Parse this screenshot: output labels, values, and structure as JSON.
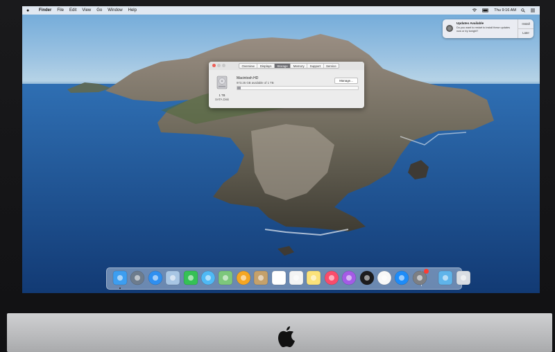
{
  "menubar": {
    "app": "Finder",
    "items": [
      "File",
      "Edit",
      "View",
      "Go",
      "Window",
      "Help"
    ],
    "clock": "Thu 9:16 AM"
  },
  "notification": {
    "title": "Updates Available",
    "body": "Do you want to restart to install these updates now or try tonight?",
    "install_label": "Install",
    "later_label": "Later"
  },
  "about_window": {
    "tabs": [
      "Overview",
      "Displays",
      "Storage",
      "Memory",
      "Support",
      "Service"
    ],
    "active_tab": "Storage",
    "disk_name": "Macintosh HD",
    "available": "973.25 GB available of 1 TB",
    "used_fraction": 0.03,
    "disk_size": "1 TB",
    "disk_type": "SATA Disk",
    "manage_label": "Manage..."
  },
  "dock": {
    "items": [
      {
        "name": "finder-icon",
        "color": "#3d9ef0"
      },
      {
        "name": "launchpad-icon",
        "color": "#6d7c8d"
      },
      {
        "name": "safari-icon",
        "color": "#2f8ff0"
      },
      {
        "name": "preview-icon",
        "color": "#a8c6e4"
      },
      {
        "name": "facetime-icon",
        "color": "#35c155"
      },
      {
        "name": "messages-icon",
        "color": "#4fb9f5"
      },
      {
        "name": "maps-icon",
        "color": "#7dc77b"
      },
      {
        "name": "photos-icon",
        "color": "#f5a623"
      },
      {
        "name": "contacts-icon",
        "color": "#c5a16b"
      },
      {
        "name": "calendar-icon",
        "color": "#ffffff"
      },
      {
        "name": "reminders-icon",
        "color": "#f4f4f4"
      },
      {
        "name": "notes-icon",
        "color": "#fbe27a"
      },
      {
        "name": "music-icon",
        "color": "#fa4c6b"
      },
      {
        "name": "podcasts-icon",
        "color": "#a45be6"
      },
      {
        "name": "tv-icon",
        "color": "#1c1c1e"
      },
      {
        "name": "news-icon",
        "color": "#f8f8f8"
      },
      {
        "name": "app-store-icon",
        "color": "#1e8cf8"
      },
      {
        "name": "system-preferences-icon",
        "color": "#7d7f83"
      },
      {
        "name": "downloads-folder-icon",
        "color": "#5fb4ea"
      },
      {
        "name": "trash-icon",
        "color": "#d8dde3"
      }
    ]
  }
}
